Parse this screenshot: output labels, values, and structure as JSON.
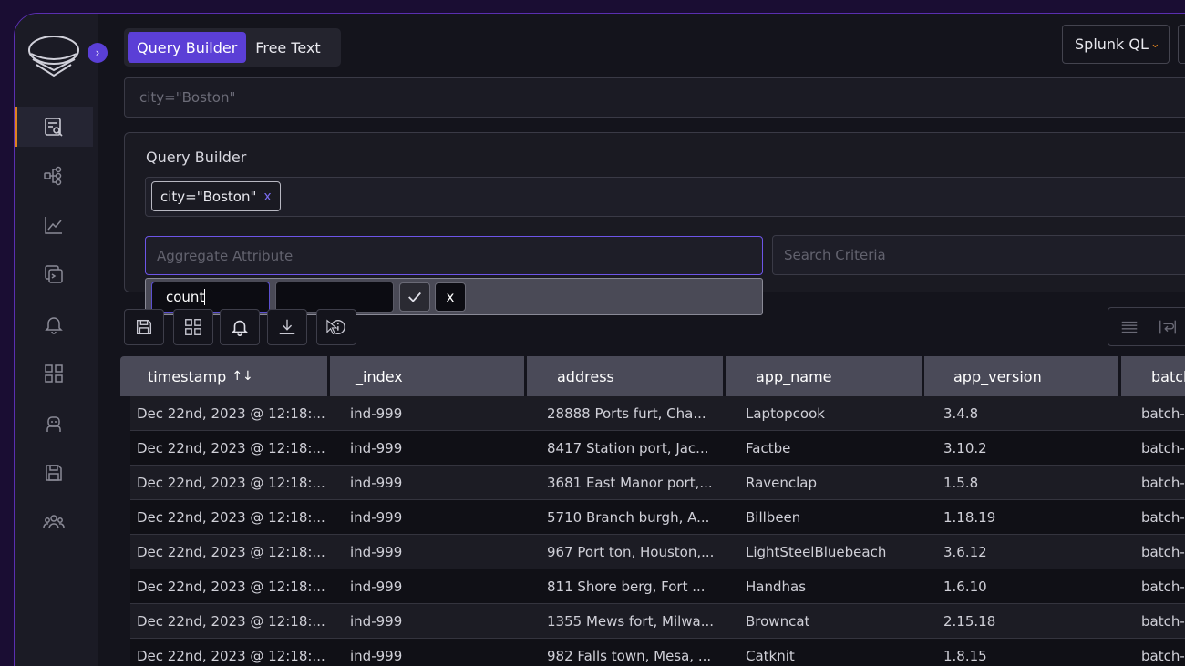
{
  "mode_toggle": {
    "query_builder": "Query Builder",
    "free_text": "Free Text"
  },
  "language_select": {
    "value": "Splunk QL"
  },
  "query_input": {
    "value": "city=\"Boston\""
  },
  "query_builder": {
    "title": "Query Builder",
    "chip": {
      "label": "city=\"Boston\"",
      "remove": "x"
    },
    "aggregate_placeholder": "Aggregate Attribute",
    "criteria_placeholder": "Search Criteria"
  },
  "aggregate_popup": {
    "function_value": "count",
    "field_value": "",
    "cancel": "x"
  },
  "table": {
    "columns": [
      "timestamp",
      "_index",
      "address",
      "app_name",
      "app_version",
      "batch"
    ],
    "rows": [
      [
        "Dec 22nd, 2023 @ 12:18:...",
        "ind-999",
        "28888 Ports furt, Cha...",
        "Laptopcook",
        "3.4.8",
        "batch-"
      ],
      [
        "Dec 22nd, 2023 @ 12:18:...",
        "ind-999",
        "8417 Station port, Jac...",
        "Factbe",
        "3.10.2",
        "batch-"
      ],
      [
        "Dec 22nd, 2023 @ 12:18:...",
        "ind-999",
        "3681 East Manor port,...",
        "Ravenclap",
        "1.5.8",
        "batch-"
      ],
      [
        "Dec 22nd, 2023 @ 12:18:...",
        "ind-999",
        "5710 Branch burgh, A...",
        "Billbeen",
        "1.18.19",
        "batch-"
      ],
      [
        "Dec 22nd, 2023 @ 12:18:...",
        "ind-999",
        "967 Port ton, Houston,...",
        "LightSteelBluebeach",
        "3.6.12",
        "batch-"
      ],
      [
        "Dec 22nd, 2023 @ 12:18:...",
        "ind-999",
        "811 Shore berg, Fort ...",
        "Handhas",
        "1.6.10",
        "batch-"
      ],
      [
        "Dec 22nd, 2023 @ 12:18:...",
        "ind-999",
        "1355 Mews fort, Milwa...",
        "Browncat",
        "2.15.18",
        "batch-"
      ],
      [
        "Dec 22nd, 2023 @ 12:18:...",
        "ind-999",
        "982 Falls town, Mesa, ...",
        "Catknit",
        "1.8.15",
        "batch-"
      ]
    ]
  },
  "colors": {
    "accent": "#5b3fd6",
    "active_indicator": "#e0831f",
    "frame_border": "#5a2fb0"
  }
}
